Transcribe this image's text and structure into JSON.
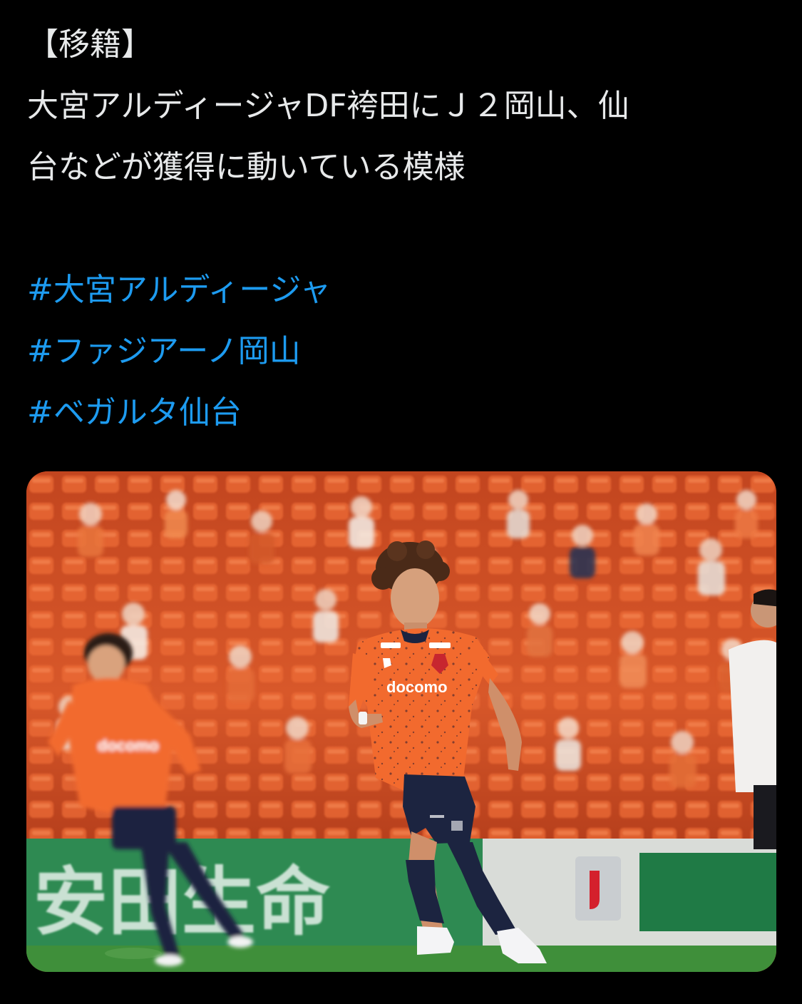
{
  "tweet": {
    "text_lines": [
      "【移籍】",
      "大宮アルディージャDF袴田にＪ２岡山、仙",
      "台などが獲得に動いている模様"
    ],
    "hashtags": [
      "#大宮アルディージャ",
      "#ファジアーノ岡山",
      "#ベガルタ仙台"
    ],
    "media": {
      "sponsor_chest": "docomo",
      "sponsor_chest_far": "docomo",
      "board_text": "安田生命"
    }
  },
  "colors": {
    "background": "#000000",
    "text": "#e7e9ea",
    "hashtag": "#1d9bf0",
    "jersey": "#f26a2e",
    "shorts": "#1c2440",
    "pitch": "#3f8f3a",
    "board": "#2e8a52"
  }
}
